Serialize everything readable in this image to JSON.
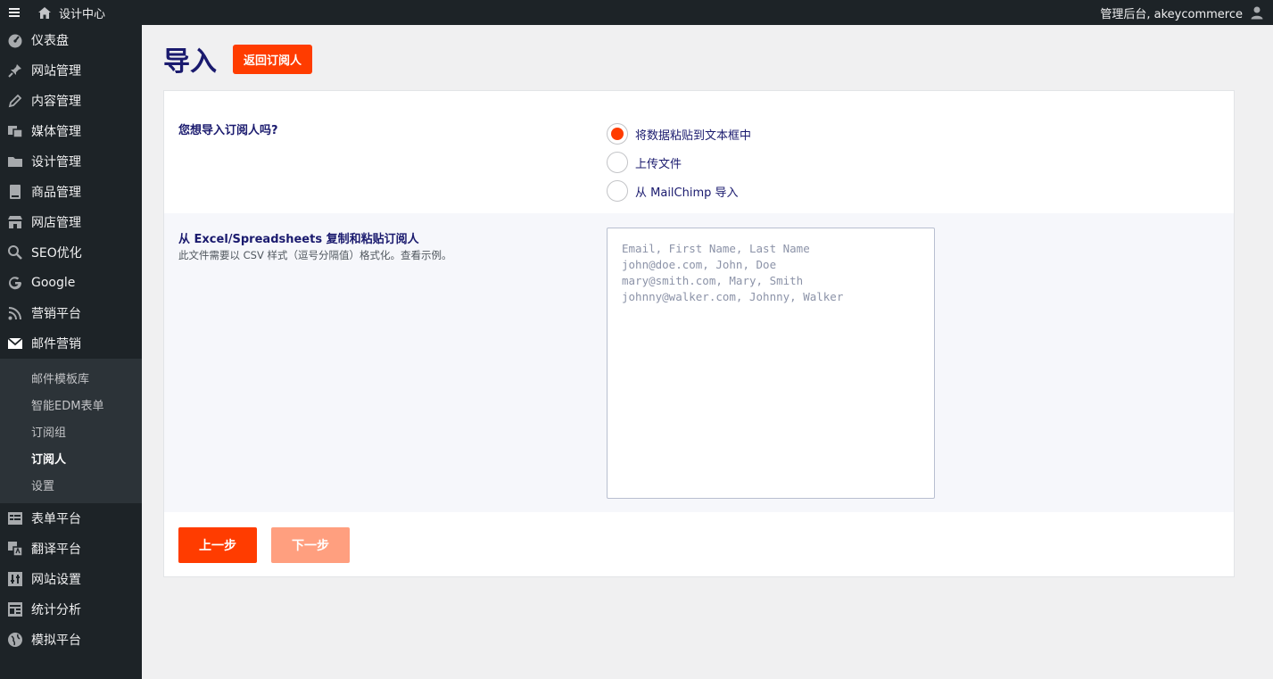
{
  "topbar": {
    "site_name": "设计中心",
    "user_greeting": "管理后台, akeycommerce"
  },
  "sidebar": {
    "items": [
      {
        "label": "仪表盘",
        "icon": "dashboard-icon"
      },
      {
        "label": "网站管理",
        "icon": "pin-icon"
      },
      {
        "label": "内容管理",
        "icon": "pencil-icon"
      },
      {
        "label": "媒体管理",
        "icon": "media-icon"
      },
      {
        "label": "设计管理",
        "icon": "folder-icon"
      },
      {
        "label": "商品管理",
        "icon": "book-icon"
      },
      {
        "label": "网店管理",
        "icon": "store-icon"
      },
      {
        "label": "SEO优化",
        "icon": "search-icon"
      },
      {
        "label": "Google",
        "icon": "google-icon"
      },
      {
        "label": "营销平台",
        "icon": "rss-icon"
      },
      {
        "label": "邮件营销",
        "icon": "mail-icon"
      },
      {
        "label": "表单平台",
        "icon": "form-icon"
      },
      {
        "label": "翻译平台",
        "icon": "translate-icon"
      },
      {
        "label": "网站设置",
        "icon": "settings-icon"
      },
      {
        "label": "统计分析",
        "icon": "analytics-icon"
      },
      {
        "label": "模拟平台",
        "icon": "globe-icon"
      }
    ],
    "submenu": [
      {
        "label": "邮件模板库"
      },
      {
        "label": "智能EDM表单"
      },
      {
        "label": "订阅组"
      },
      {
        "label": "订阅人"
      },
      {
        "label": "设置"
      }
    ]
  },
  "page": {
    "title": "导入",
    "back_button": "返回订阅人"
  },
  "form": {
    "question": "您想导入订阅人吗?",
    "options": [
      {
        "label": "将数据粘贴到文本框中",
        "checked": true
      },
      {
        "label": "上传文件",
        "checked": false
      },
      {
        "label": "从 MailChimp 导入",
        "checked": false
      }
    ],
    "paste_title": "从 Excel/Spreadsheets 复制和粘贴订阅人",
    "paste_desc": "此文件需要以 CSV 样式（逗号分隔值）格式化。查看示例。",
    "textarea_placeholder": "Email, First Name, Last Name\njohn@doe.com, John, Doe\nmary@smith.com, Mary, Smith\njohnny@walker.com, Johnny, Walker",
    "prev_button": "上一步",
    "next_button": "下一步"
  },
  "colors": {
    "accent": "#ff3c00",
    "accent_disabled": "#ff9f7f",
    "title": "#1a1a6e",
    "sidebar_bg": "#1d2327"
  }
}
